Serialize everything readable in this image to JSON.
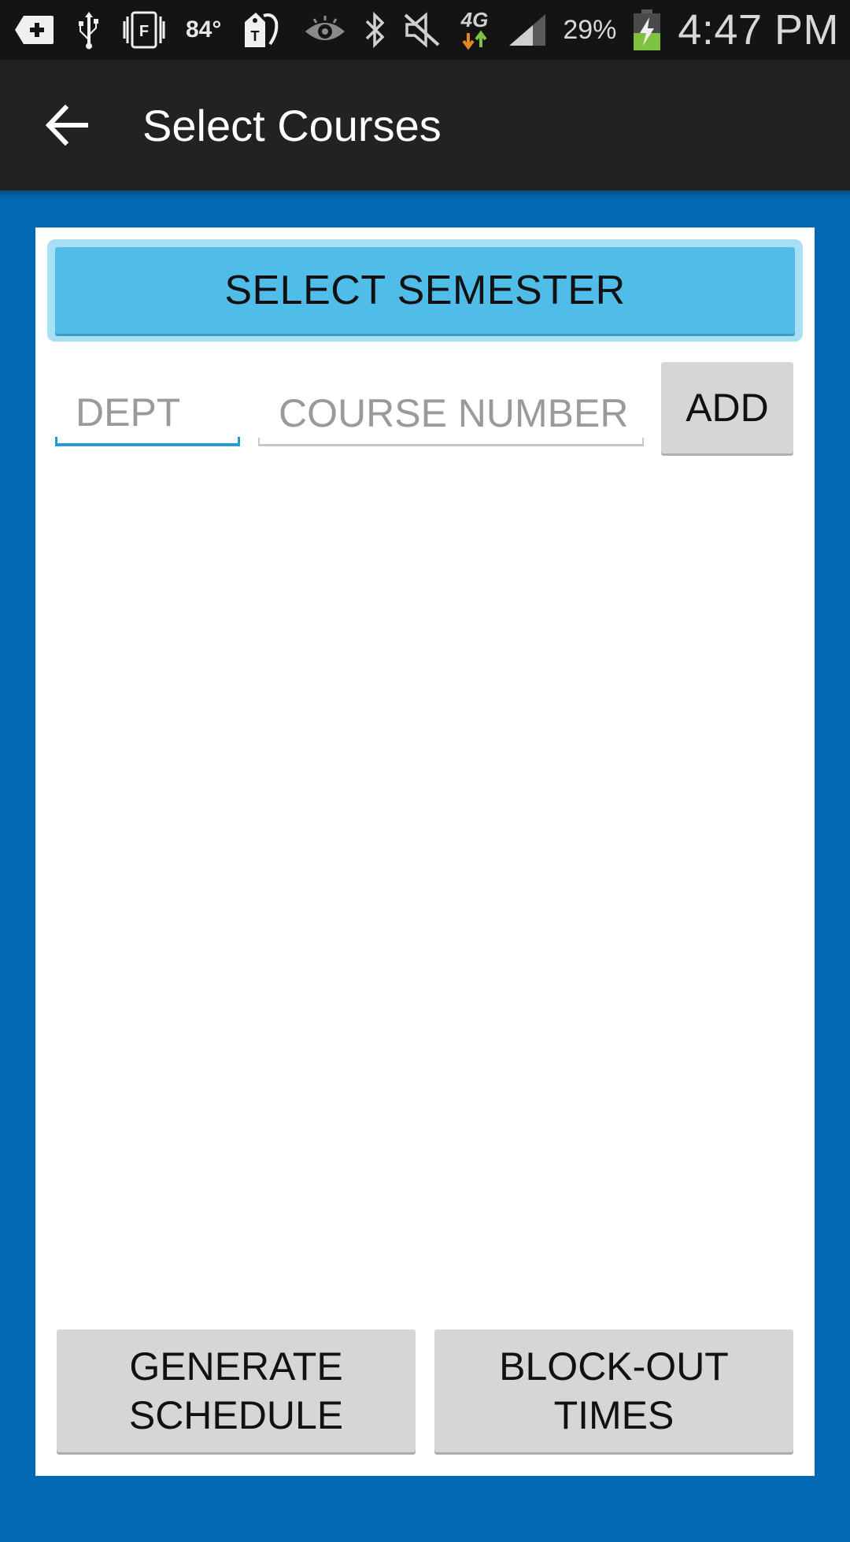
{
  "status_bar": {
    "icons_left": [
      "add-box-icon",
      "usb-icon",
      "vibrate-frame-icon",
      "weather-temp",
      "tmobile-tag-icon"
    ],
    "temperature": "84°",
    "icons_right": [
      "eye-icon",
      "bluetooth-icon",
      "mute-icon",
      "4g-data-icon",
      "signal-icon",
      "battery-charging-icon"
    ],
    "network_label": "4G",
    "battery_percent": "29%",
    "time": "4:47 PM"
  },
  "app_bar": {
    "back_icon": "arrow-left-icon",
    "title": "Select Courses"
  },
  "main": {
    "select_semester_label": "SELECT SEMESTER",
    "dept_placeholder": "DEPT",
    "dept_value": "",
    "course_number_placeholder": "COURSE NUMBER",
    "course_number_value": "",
    "add_label": "ADD",
    "courses": [],
    "generate_schedule_label": [
      "GENERATE",
      "SCHEDULE"
    ],
    "block_out_times_label": [
      "BLOCK-OUT",
      "TIMES"
    ]
  },
  "colors": {
    "background": "#0068b4",
    "app_bar": "#222222",
    "status_bar": "#141414",
    "accent_button": "#4fbde8",
    "accent_focus": "#2a9ad5",
    "secondary_button": "#d6d6d6"
  }
}
